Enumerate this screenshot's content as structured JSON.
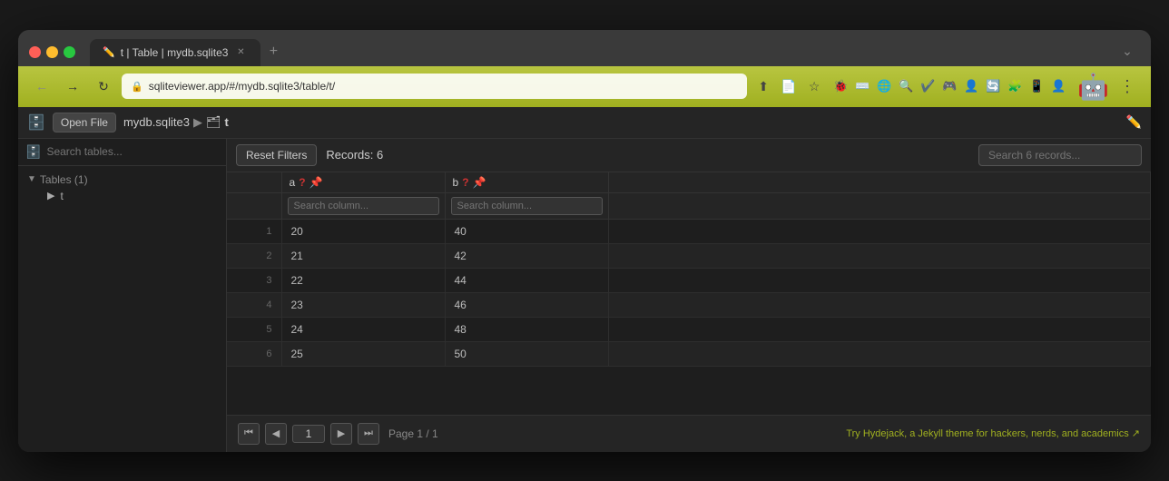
{
  "browser": {
    "tab_label": "t | Table | mydb.sqlite3",
    "address": "sqliteviewer.app/#/mydb.sqlite3/table/t/",
    "new_tab_icon": "+",
    "chevron_icon": "⌄"
  },
  "app": {
    "open_file_label": "Open File",
    "breadcrumb": {
      "db": "mydb.sqlite3",
      "separator": "▶",
      "table_icon": "🗂",
      "table": "t"
    },
    "sidebar": {
      "search_placeholder": "Search tables...",
      "tables_section_label": "Tables (1)",
      "table_item": "t"
    },
    "toolbar": {
      "reset_filters_label": "Reset Filters",
      "records_count": "Records: 6",
      "search_placeholder": "Search 6 records..."
    },
    "columns": [
      {
        "name": "a",
        "question_icon": "?",
        "pin_icon": "📌",
        "search_placeholder": "Search column..."
      },
      {
        "name": "b",
        "question_icon": "?",
        "pin_icon": "📌",
        "search_placeholder": "Search column..."
      }
    ],
    "rows": [
      {
        "row_num": 1,
        "a": 20,
        "b": 40
      },
      {
        "row_num": 2,
        "a": 21,
        "b": 42
      },
      {
        "row_num": 3,
        "a": 22,
        "b": 44
      },
      {
        "row_num": 4,
        "a": 23,
        "b": 46
      },
      {
        "row_num": 5,
        "a": 24,
        "b": 48
      },
      {
        "row_num": 6,
        "a": 25,
        "b": 50
      }
    ],
    "pagination": {
      "first_icon": "⏮",
      "prev_icon": "◀",
      "next_icon": "▶",
      "last_icon": "⏭",
      "current_page": "1",
      "page_info": "Page 1 / 1",
      "promo_text": "Try Hydejack, a Jekyll theme for hackers, nerds, and academics ↗"
    }
  },
  "nav": {
    "back_icon": "←",
    "forward_icon": "→",
    "refresh_icon": "↻",
    "lock_icon": "🔒",
    "download_icon": "⬇",
    "bookmark_icon": "☆"
  }
}
